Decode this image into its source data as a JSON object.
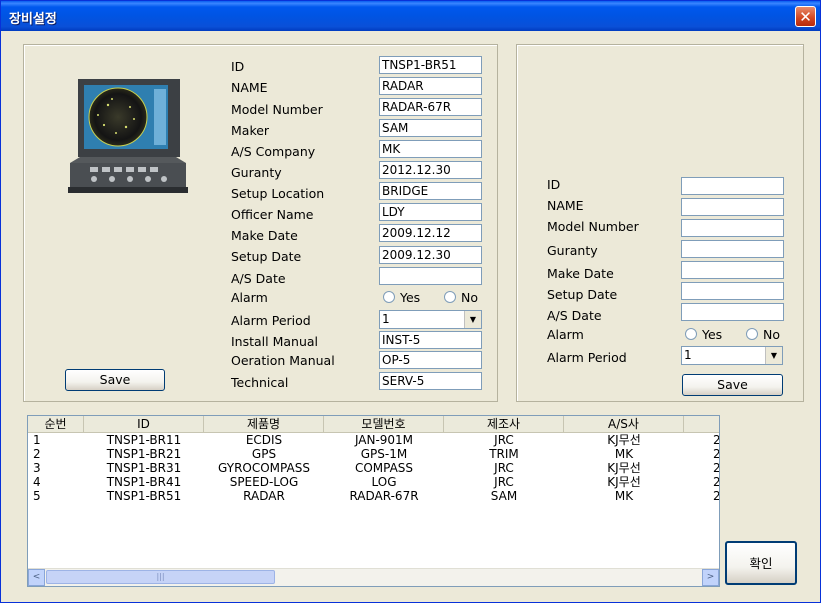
{
  "window": {
    "title": "장비설정",
    "close_label": "✕"
  },
  "left_form": {
    "labels": [
      "ID",
      "NAME",
      "Model Number",
      "Maker",
      "A/S Company",
      "Guranty",
      "Setup Location",
      "Officer Name",
      "Make Date",
      "Setup Date",
      "A/S Date",
      "Alarm",
      "Alarm Period",
      "Install Manual",
      "Oeration Manual",
      "Technical"
    ],
    "values": {
      "id": "TNSP1-BR51",
      "name": "RADAR",
      "model_number": "RADAR-67R",
      "maker": "SAM",
      "as_company": "MK",
      "guranty": "2012.12.30",
      "setup_location": "BRIDGE",
      "officer_name": "LDY",
      "make_date": "2009.12.12",
      "setup_date": "2009.12.30",
      "as_date": "",
      "alarm_period": "1",
      "install_manual": "INST-5",
      "operation_manual": "OP-5",
      "technical": "SERV-5"
    },
    "alarm_yes": "Yes",
    "alarm_no": "No",
    "save_label": "Save"
  },
  "right_form": {
    "labels": [
      "ID",
      "NAME",
      "Model Number",
      "Guranty",
      "Make Date",
      "Setup Date",
      "A/S Date",
      "Alarm",
      "Alarm Period"
    ],
    "values": {
      "id": "",
      "name": "",
      "model_number": "",
      "guranty": "",
      "make_date": "",
      "setup_date": "",
      "as_date": "",
      "alarm_period": "1"
    },
    "alarm_yes": "Yes",
    "alarm_no": "No",
    "save_label": "Save"
  },
  "table": {
    "columns": [
      "순번",
      "ID",
      "제품명",
      "모델번호",
      "제조사",
      "A/S사",
      ""
    ],
    "rows": [
      [
        "1",
        "TNSP1-BR11",
        "ECDIS",
        "JAN-901M",
        "JRC",
        "KJ무선",
        "2"
      ],
      [
        "2",
        "TNSP1-BR21",
        "GPS",
        "GPS-1M",
        "TRIM",
        "MK",
        "2"
      ],
      [
        "3",
        "TNSP1-BR31",
        "GYROCOMPASS",
        "COMPASS",
        "JRC",
        "KJ무선",
        "2"
      ],
      [
        "4",
        "TNSP1-BR41",
        "SPEED-LOG",
        "LOG",
        "JRC",
        "KJ무선",
        "2"
      ],
      [
        "5",
        "TNSP1-BR51",
        "RADAR",
        "RADAR-67R",
        "SAM",
        "MK",
        "2"
      ]
    ],
    "scroll_left": "<",
    "scroll_right": ">",
    "thumb_grip": "|||"
  },
  "confirm_label": "확인",
  "icons": {
    "close": "close-icon",
    "dropdown": "chevron-down-icon",
    "equipment": "radar-display-icon"
  }
}
